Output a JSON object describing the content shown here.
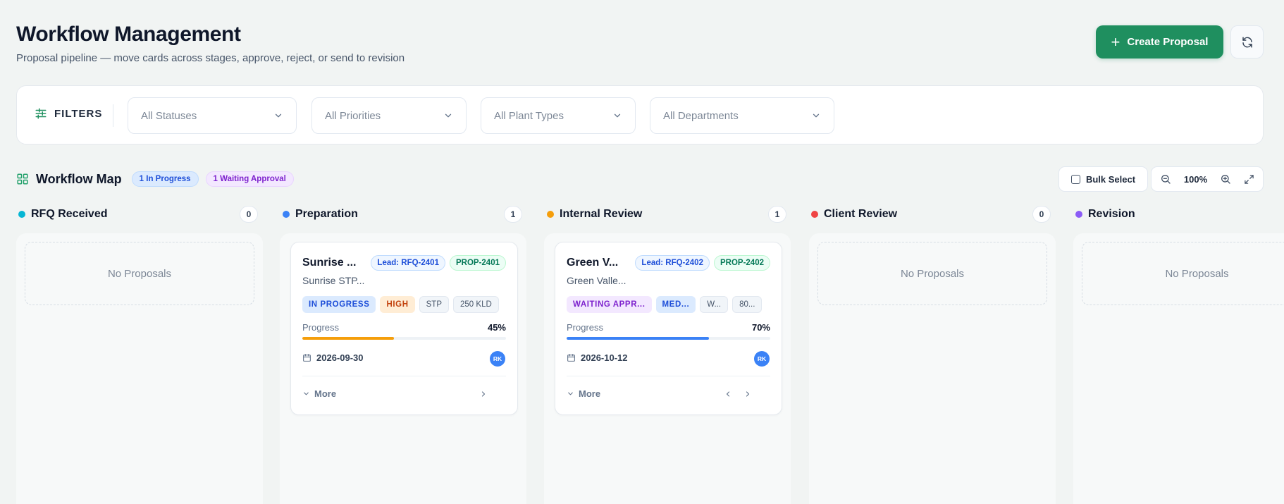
{
  "header": {
    "title": "Workflow Management",
    "subtitle": "Proposal pipeline — move cards across stages, approve, reject, or send to revision",
    "create_label": "Create Proposal"
  },
  "filters": {
    "label": "FILTERS",
    "status": "All Statuses",
    "priority": "All Priorities",
    "plant_type": "All Plant Types",
    "department": "All Departments"
  },
  "map": {
    "title": "Workflow Map",
    "in_progress_pill": "1 In Progress",
    "waiting_pill": "1 Waiting Approval",
    "bulk_label": "Bulk Select",
    "zoom": "100%"
  },
  "columns": [
    {
      "name": "RFQ Received",
      "count": "0",
      "color": "#06b6d4",
      "empty": "No Proposals"
    },
    {
      "name": "Preparation",
      "count": "1",
      "color": "#3b82f6"
    },
    {
      "name": "Internal Review",
      "count": "1",
      "color": "#f59e0b"
    },
    {
      "name": "Client Review",
      "count": "0",
      "color": "#ef4444",
      "empty": "No Proposals"
    },
    {
      "name": "Revision",
      "color": "#8b5cf6",
      "empty": "No Proposals"
    }
  ],
  "cards": [
    {
      "title": "Sunrise ...",
      "lead": "Lead: RFQ-2401",
      "prop": "PROP-2401",
      "subtitle": "Sunrise STP...",
      "status": "IN PROGRESS",
      "priority": "HIGH",
      "plant": "STP",
      "capacity": "250 KLD",
      "progress_label": "Progress",
      "progress": "45%",
      "progress_value": 45,
      "progress_color": "#f59e0b",
      "date": "2026-09-30",
      "avatar": "RK",
      "more": "More"
    },
    {
      "title": "Green V...",
      "lead": "Lead: RFQ-2402",
      "prop": "PROP-2402",
      "subtitle": "Green Valle...",
      "status": "WAITING APPR...",
      "priority": "MED...",
      "plant": "W...",
      "capacity": "80...",
      "progress_label": "Progress",
      "progress": "70%",
      "progress_value": 70,
      "progress_color": "#3b82f6",
      "date": "2026-10-12",
      "avatar": "RK",
      "more": "More"
    }
  ]
}
